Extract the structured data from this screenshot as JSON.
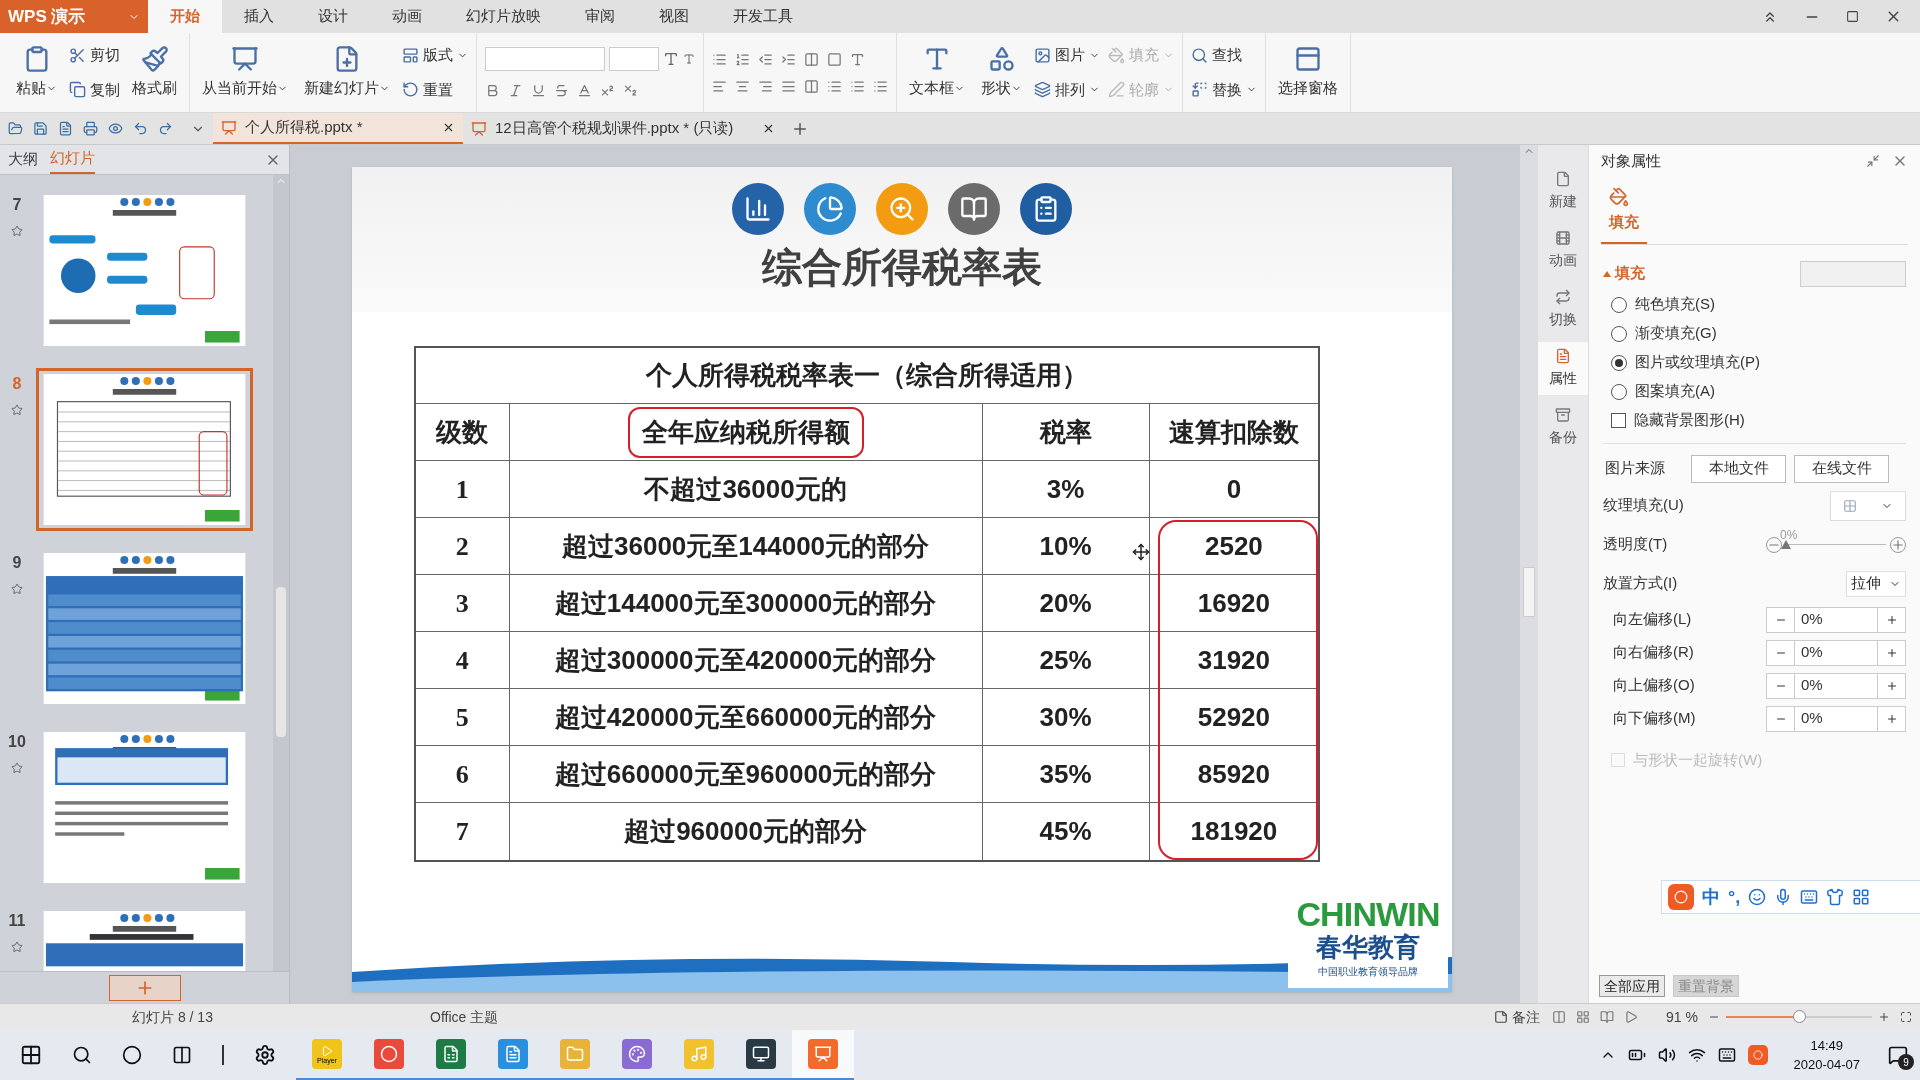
{
  "app_menu": {
    "label": "WPS 演示"
  },
  "menu_tabs": [
    {
      "label": "开始",
      "selected": true
    },
    {
      "label": "插入",
      "selected": false
    },
    {
      "label": "设计",
      "selected": false
    },
    {
      "label": "动画",
      "selected": false
    },
    {
      "label": "幻灯片放映",
      "selected": false
    },
    {
      "label": "审阅",
      "selected": false
    },
    {
      "label": "视图",
      "selected": false
    },
    {
      "label": "开发工具",
      "selected": false
    }
  ],
  "ribbon": {
    "groups": [
      {
        "items": [
          {
            "kind": "large",
            "label": "粘贴",
            "dropdown": true,
            "disabled": false
          },
          {
            "kind": "stack",
            "items": [
              {
                "label": "剪切",
                "dropdown": false,
                "disabled": false
              },
              {
                "label": "复制",
                "dropdown": false,
                "disabled": false
              }
            ]
          },
          {
            "kind": "large",
            "label": "格式刷",
            "dropdown": false,
            "disabled": false
          }
        ]
      },
      {
        "items": [
          {
            "kind": "large",
            "label": "从当前开始",
            "dropdown": true,
            "disabled": false
          },
          {
            "kind": "large",
            "label": "新建幻灯片",
            "dropdown": true,
            "disabled": false
          },
          {
            "kind": "stack",
            "items": [
              {
                "label": "版式",
                "dropdown": true,
                "disabled": false
              },
              {
                "label": "重置",
                "dropdown": false,
                "disabled": false
              }
            ]
          }
        ]
      },
      {
        "items": [
          {
            "kind": "font_tools"
          }
        ]
      },
      {
        "items": [
          {
            "kind": "paragraph_tools"
          }
        ]
      },
      {
        "items": [
          {
            "kind": "large",
            "label": "文本框",
            "dropdown": true,
            "disabled": false
          },
          {
            "kind": "large",
            "label": "形状",
            "dropdown": true,
            "disabled": false
          },
          {
            "kind": "stack",
            "items": [
              {
                "label": "图片",
                "dropdown": true,
                "disabled": false
              },
              {
                "label": "排列",
                "dropdown": true,
                "disabled": false
              }
            ]
          },
          {
            "kind": "stack",
            "items": [
              {
                "label": "填充",
                "dropdown": true,
                "disabled": true
              },
              {
                "label": "轮廓",
                "dropdown": true,
                "disabled": true
              }
            ]
          }
        ]
      },
      {
        "items": [
          {
            "kind": "stack",
            "items": [
              {
                "label": "查找",
                "dropdown": false,
                "disabled": false
              },
              {
                "label": "替换",
                "dropdown": true,
                "disabled": false
              }
            ]
          }
        ]
      },
      {
        "items": [
          {
            "kind": "large",
            "label": "选择窗格",
            "dropdown": false,
            "disabled": false
          }
        ]
      }
    ]
  },
  "doc_tabs": [
    {
      "label": "个人所得税.pptx *",
      "selected": true
    },
    {
      "label": "12日高管个税规划课件.pptx * (只读)",
      "selected": false
    }
  ],
  "left_panel": {
    "tabs": [
      {
        "label": "大纲",
        "selected": false
      },
      {
        "label": "幻灯片",
        "selected": true
      }
    ],
    "slides": [
      {
        "number": "7",
        "kind": "mindmap",
        "selected": false
      },
      {
        "number": "8",
        "kind": "table",
        "selected": true
      },
      {
        "number": "9",
        "kind": "blue_table",
        "selected": false
      },
      {
        "number": "10",
        "kind": "table_text",
        "selected": false
      },
      {
        "number": "11",
        "kind": "partial",
        "selected": false
      }
    ]
  },
  "slide": {
    "title": "综合所得税率表",
    "table": {
      "caption": "个人所得税税率表一（综合所得适用）",
      "columns": [
        "级数",
        "全年应纳税所得额",
        "税率",
        "速算扣除数"
      ],
      "rows": [
        [
          "1",
          "不超过36000元的",
          "3%",
          "0"
        ],
        [
          "2",
          "超过36000元至144000元的部分",
          "10%",
          "2520"
        ],
        [
          "3",
          "超过144000元至300000元的部分",
          "20%",
          "16920"
        ],
        [
          "4",
          "超过300000元至420000元的部分",
          "25%",
          "31920"
        ],
        [
          "5",
          "超过420000元至660000元的部分",
          "30%",
          "52920"
        ],
        [
          "6",
          "超过660000元至960000元的部分",
          "35%",
          "85920"
        ],
        [
          "7",
          "超过960000元的部分",
          "45%",
          "181920"
        ]
      ]
    },
    "logo": {
      "brand": "CHINWIN",
      "name": "春华教育",
      "tagline": "中国职业教育领导品牌"
    }
  },
  "side_tabs": [
    {
      "label": "新建",
      "selected": false
    },
    {
      "label": "动画",
      "selected": false
    },
    {
      "label": "切换",
      "selected": false
    },
    {
      "label": "属性",
      "selected": true
    },
    {
      "label": "备份",
      "selected": false
    }
  ],
  "properties": {
    "title": "对象属性",
    "tab": "填充",
    "section": {
      "label": "填充",
      "expanded": true
    },
    "fill_options": [
      {
        "kind": "radio",
        "label": "纯色填充(S)",
        "selected": false
      },
      {
        "kind": "radio",
        "label": "渐变填充(G)",
        "selected": false
      },
      {
        "kind": "radio",
        "label": "图片或纹理填充(P)",
        "selected": true
      },
      {
        "kind": "radio",
        "label": "图案填充(A)",
        "selected": false
      },
      {
        "kind": "checkbox",
        "label": "隐藏背景图形(H)",
        "selected": false
      }
    ],
    "source": {
      "label": "图片来源",
      "buttons": [
        "本地文件",
        "在线文件"
      ]
    },
    "texture": {
      "label": "纹理填充(U)"
    },
    "transparency": {
      "label": "透明度(T)",
      "reading": "0%",
      "level": 0
    },
    "placement": {
      "label": "放置方式(I)",
      "value": "拉伸"
    },
    "offsets": [
      {
        "label": "向左偏移(L)",
        "value": "0%"
      },
      {
        "label": "向右偏移(R)",
        "value": "0%"
      },
      {
        "label": "向上偏移(O)",
        "value": "0%"
      },
      {
        "label": "向下偏移(M)",
        "value": "0%"
      }
    ],
    "rotate": {
      "label": "与形状一起旋转(W)",
      "checked": false,
      "disabled": true
    },
    "ime": {
      "mode": "中",
      "punct": "°,"
    },
    "buttons": [
      {
        "label": "全部应用",
        "disabled": false
      },
      {
        "label": "重置背景",
        "disabled": true
      }
    ]
  },
  "status_bar": {
    "slide": "幻灯片 8 / 13",
    "theme": "Office 主题",
    "notes": "备注",
    "zoom": "91 %",
    "zoom_slider": {
      "level": 0.5
    }
  },
  "taskbar": {
    "apps": [
      {
        "running": true,
        "selected": false,
        "label": "Player"
      },
      {
        "running": true,
        "selected": false
      },
      {
        "running": true,
        "selected": false
      },
      {
        "running": true,
        "selected": false
      },
      {
        "running": true,
        "selected": false
      },
      {
        "running": true,
        "selected": false
      },
      {
        "running": true,
        "selected": false
      },
      {
        "running": true,
        "selected": false
      },
      {
        "running": true,
        "selected": true
      }
    ],
    "time": "14:49",
    "date": "2020-04-07",
    "notifications": "9"
  }
}
